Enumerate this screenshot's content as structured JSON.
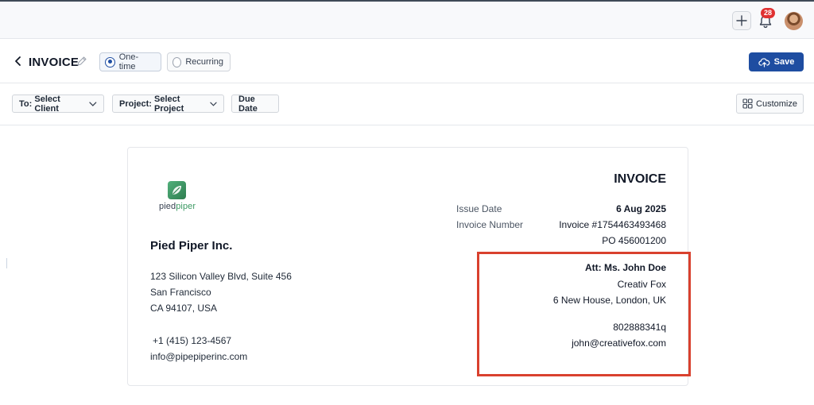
{
  "topbar": {
    "notifications_count": "28",
    "add_icon": "plus-icon",
    "bell_icon": "bell-icon"
  },
  "header": {
    "title": "INVOICE",
    "types": [
      {
        "label": "One-time",
        "selected": true
      },
      {
        "label": "Recurring",
        "selected": false
      }
    ],
    "save_label": "Save"
  },
  "filters": {
    "client_label": "To:",
    "client_value": "Select Client",
    "project_label": "Project:",
    "project_value": "Select Project",
    "due_date_label": "Due Date",
    "customize_label": "Customize"
  },
  "invoice": {
    "logo": {
      "part1": "pied",
      "part2": "piper"
    },
    "company_name": "Pied Piper Inc.",
    "address_line1": "123 Silicon Valley Blvd, Suite 456",
    "address_line2": "San Francisco",
    "address_line3": "CA 94107, USA",
    "phone": "+1 (415) 123-4567",
    "email": "info@pipepiperinc.com",
    "heading": "INVOICE",
    "issue_date_label": "Issue Date",
    "issue_date": "6 Aug 2025",
    "invoice_number_label": "Invoice Number",
    "invoice_number": "Invoice #1754463493468",
    "po_number": "PO 456001200",
    "client": {
      "attention": "Att: Ms. John Doe",
      "company": "Creativ Fox",
      "address": "6 New House, London, UK",
      "phone": "802888341q",
      "email": "john@creativefox.com"
    }
  },
  "colors": {
    "primary": "#1e4da1",
    "highlight": "#d9412e",
    "badge": "#e03131",
    "logo_green": "#3c9a63"
  }
}
